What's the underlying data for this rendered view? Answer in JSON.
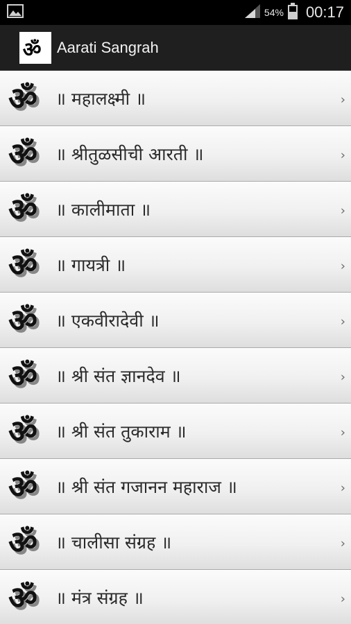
{
  "status_bar": {
    "battery_percent": "54%",
    "time": "00:17",
    "icons": [
      "image-notification-icon",
      "signal-icon",
      "battery-icon"
    ]
  },
  "app_bar": {
    "title": "Aarati Sangrah",
    "logo": "om-logo-icon"
  },
  "list": {
    "items": [
      {
        "label": "॥ महालक्ष्मी ॥",
        "icon": "om-icon"
      },
      {
        "label": "॥ श्रीतुळसीची आरती ॥",
        "icon": "om-icon"
      },
      {
        "label": "॥ कालीमाता ॥",
        "icon": "om-icon"
      },
      {
        "label": "॥ गायत्री ॥",
        "icon": "om-icon"
      },
      {
        "label": "॥ एकवीरादेवी ॥",
        "icon": "om-icon"
      },
      {
        "label": "॥ श्री संत ज्ञानदेव ॥",
        "icon": "om-icon"
      },
      {
        "label": "॥ श्री संत तुकाराम ॥",
        "icon": "om-icon"
      },
      {
        "label": "॥ श्री संत गजानन महाराज ॥",
        "icon": "om-icon"
      },
      {
        "label": "॥ चालीसा संग्रह ॥",
        "icon": "om-icon"
      },
      {
        "label": "॥ मंत्र संग्रह ॥",
        "icon": "om-icon"
      }
    ],
    "chevron": "›"
  }
}
